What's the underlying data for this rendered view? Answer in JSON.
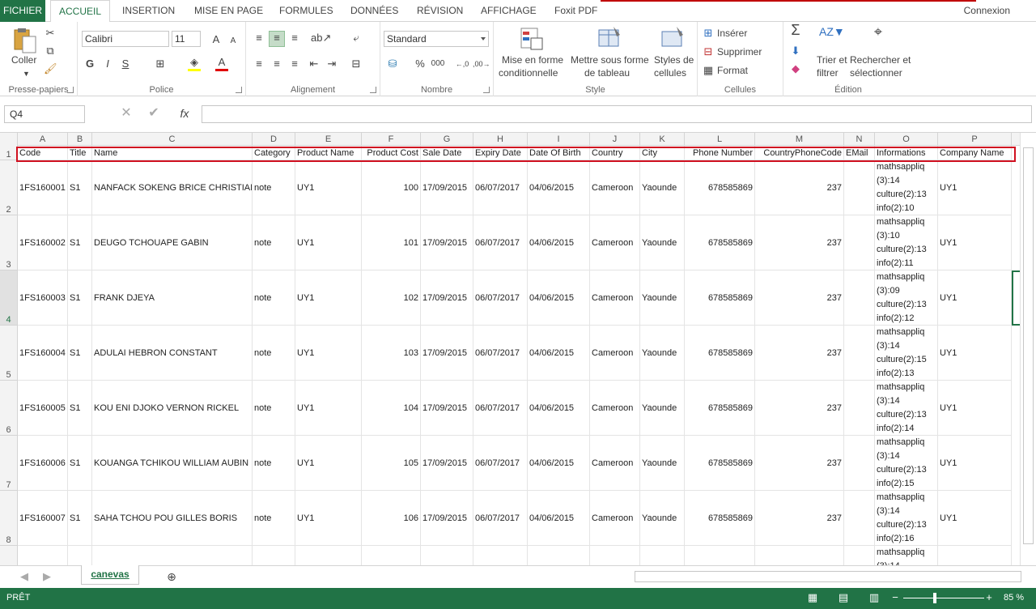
{
  "tabs": [
    "FICHIER",
    "ACCUEIL",
    "INSERTION",
    "MISE EN PAGE",
    "FORMULES",
    "DONNÉES",
    "RÉVISION",
    "AFFICHAGE",
    "Foxit PDF"
  ],
  "account": "Connexion",
  "ribbon": {
    "clipboard": {
      "label": "Presse-papiers",
      "paste": "Coller"
    },
    "font": {
      "label": "Police",
      "name": "Calibri",
      "size": "11",
      "bold": "G",
      "italic": "I",
      "underline": "S"
    },
    "alignment": {
      "label": "Alignement"
    },
    "number": {
      "label": "Nombre",
      "format": "Standard"
    },
    "style": {
      "label": "Style",
      "cond1": "Mise en forme",
      "cond2": "conditionnelle",
      "table1": "Mettre sous forme",
      "table2": "de tableau",
      "cell1": "Styles de",
      "cell2": "cellules"
    },
    "cells": {
      "label": "Cellules",
      "insert": "Insérer",
      "delete": "Supprimer",
      "format": "Format"
    },
    "editing": {
      "label": "Édition",
      "sort1": "Trier et",
      "sort2": "filtrer",
      "find1": "Rechercher et",
      "find2": "sélectionner"
    }
  },
  "formula_bar": {
    "name_box": "Q4",
    "fx": "fx",
    "value": ""
  },
  "columns": [
    "A",
    "B",
    "C",
    "D",
    "E",
    "F",
    "G",
    "H",
    "I",
    "J",
    "K",
    "L",
    "M",
    "N",
    "O",
    "P"
  ],
  "headers": [
    "Code",
    "Title",
    "Name",
    "Category",
    "Product Name",
    "Product Cost",
    "Sale Date",
    "Expiry Date",
    "Date Of Birth",
    "Country",
    "City",
    "Phone Number",
    "CountryPhoneCode",
    "EMail",
    "Informations",
    "Company Name"
  ],
  "rows": [
    {
      "num": "2",
      "cells": [
        "1FS160001",
        "S1",
        "NANFACK SOKENG BRICE CHRISTIAN",
        "note",
        "UY1",
        "100",
        "17/09/2015",
        "06/07/2017",
        "04/06/2015",
        "Cameroon",
        "Yaounde",
        "678585869",
        "237",
        "",
        "mathsappliq (3):14 culture(2):13 info(2):10",
        "UY1"
      ]
    },
    {
      "num": "3",
      "cells": [
        "1FS160002",
        "S1",
        "DEUGO TCHOUAPE GABIN",
        "note",
        "UY1",
        "101",
        "17/09/2015",
        "06/07/2017",
        "04/06/2015",
        "Cameroon",
        "Yaounde",
        "678585869",
        "237",
        "",
        "mathsappliq (3):10 culture(2):13 info(2):11",
        "UY1"
      ]
    },
    {
      "num": "4",
      "cells": [
        "1FS160003",
        "S1",
        "FRANK DJEYA",
        "note",
        "UY1",
        "102",
        "17/09/2015",
        "06/07/2017",
        "04/06/2015",
        "Cameroon",
        "Yaounde",
        "678585869",
        "237",
        "",
        "mathsappliq (3):09 culture(2):13 info(2):12",
        "UY1"
      ]
    },
    {
      "num": "5",
      "cells": [
        "1FS160004",
        "S1",
        "ADULAI HEBRON CONSTANT",
        "note",
        "UY1",
        "103",
        "17/09/2015",
        "06/07/2017",
        "04/06/2015",
        "Cameroon",
        "Yaounde",
        "678585869",
        "237",
        "",
        "mathsappliq (3):14 culture(2):15 info(2):13",
        "UY1"
      ]
    },
    {
      "num": "6",
      "cells": [
        "1FS160005",
        "S1",
        "KOU ENI DJOKO VERNON RICKEL",
        "note",
        "UY1",
        "104",
        "17/09/2015",
        "06/07/2017",
        "04/06/2015",
        "Cameroon",
        "Yaounde",
        "678585869",
        "237",
        "",
        "mathsappliq (3):14 culture(2):13 info(2):14",
        "UY1"
      ]
    },
    {
      "num": "7",
      "cells": [
        "1FS160006",
        "S1",
        "KOUANGA TCHIKOU WILLIAM AUBIN",
        "note",
        "UY1",
        "105",
        "17/09/2015",
        "06/07/2017",
        "04/06/2015",
        "Cameroon",
        "Yaounde",
        "678585869",
        "237",
        "",
        "mathsappliq (3):14 culture(2):13 info(2):15",
        "UY1"
      ]
    },
    {
      "num": "8",
      "cells": [
        "1FS160007",
        "S1",
        "SAHA TCHOU POU GILLES BORIS",
        "note",
        "UY1",
        "106",
        "17/09/2015",
        "06/07/2017",
        "04/06/2015",
        "Cameroon",
        "Yaounde",
        "678585869",
        "237",
        "",
        "mathsappliq (3):14 culture(2):13 info(2):16",
        "UY1"
      ]
    },
    {
      "num": "",
      "cells": [
        "",
        "",
        "",
        "",
        "",
        "",
        "",
        "",
        "",
        "",
        "",
        "",
        "",
        "",
        "mathsappliq (3):14",
        "",
        ""
      ]
    }
  ],
  "sheet": "canevas",
  "status": {
    "ready": "PRÊT",
    "zoom": "85 %"
  },
  "colors": {
    "accent": "#217346",
    "highlight": "#d01020"
  }
}
